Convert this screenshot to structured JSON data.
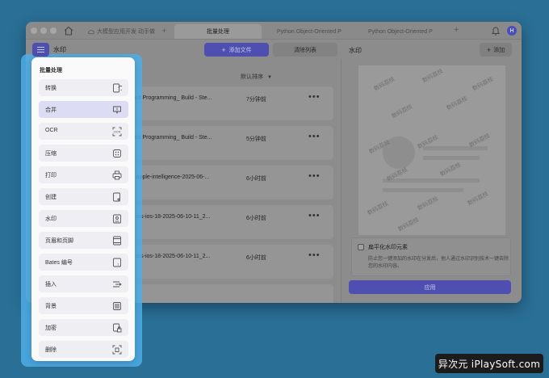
{
  "window": {
    "tabs": [
      {
        "label": "大模型应用开发 动手做",
        "active": false
      },
      {
        "label": "批量处理",
        "active": true
      },
      {
        "label": "Python Object-Oriented P",
        "active": false
      },
      {
        "label": "Python Object-Oriented P",
        "active": false
      }
    ],
    "new_tab": "+",
    "avatar_initial": "H"
  },
  "toolbar": {
    "app_label": "水印",
    "add_files": "添加文件",
    "clear_list": "清除列表",
    "watermark_title": "水印",
    "add": "添加"
  },
  "list": {
    "sort_label": "默认排序",
    "files": [
      {
        "name": "ented Programming_ Build - Ste...",
        "time": "7分钟前"
      },
      {
        "name": "ented Programming_ Build - Ste...",
        "time": "5分钟前"
      },
      {
        "name": "ple-apple-intelligence-2025-06-...",
        "time": "6小时前"
      },
      {
        "name": "ple-ios-ios-18-2025-06-10-11_2...",
        "time": "6小时前"
      },
      {
        "name": "ple-ios-ios-18-2025-06-10-11_2...",
        "time": "6小时前"
      }
    ],
    "more": "•••"
  },
  "preview": {
    "watermark_text": "数码荔枝"
  },
  "option": {
    "title": "扁平化水印元素",
    "description": "防止您一键添加的水印在分发后，他人通过水印识别技术一键去除您的水印内容。",
    "apply": "应用"
  },
  "panel": {
    "title": "批量处理",
    "items": [
      {
        "label": "转换",
        "icon": "convert-icon"
      },
      {
        "label": "合并",
        "icon": "merge-icon"
      },
      {
        "label": "OCR",
        "icon": "ocr-icon"
      },
      {
        "label": "压缩",
        "icon": "compress-icon"
      },
      {
        "label": "打印",
        "icon": "print-icon"
      },
      {
        "label": "创建",
        "icon": "create-icon"
      },
      {
        "label": "水印",
        "icon": "watermark-icon"
      },
      {
        "label": "页眉和页脚",
        "icon": "header-footer-icon"
      },
      {
        "label": "Bates 编号",
        "icon": "bates-icon"
      },
      {
        "label": "插入",
        "icon": "insert-icon"
      },
      {
        "label": "背景",
        "icon": "background-icon"
      },
      {
        "label": "加密",
        "icon": "encrypt-icon"
      },
      {
        "label": "删除",
        "icon": "delete-icon"
      }
    ],
    "selected_index": 1
  },
  "brand": {
    "text": "异次元 iPlaySoft.com"
  },
  "colors": {
    "accent": "#4e4fb0",
    "highlight": "#4eaee8",
    "background": "#2a6f96"
  }
}
